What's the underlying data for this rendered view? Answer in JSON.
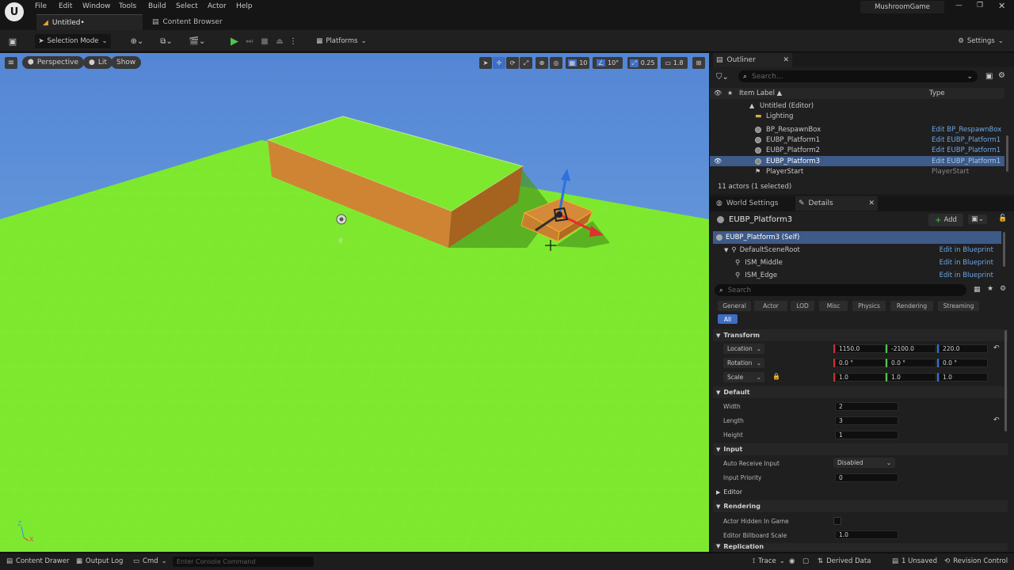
{
  "menu": [
    "File",
    "Edit",
    "Window",
    "Tools",
    "Build",
    "Select",
    "Actor",
    "Help"
  ],
  "project_name": "MushroomGame",
  "tabs": {
    "level": "Untitled•",
    "content_browser": "Content Browser"
  },
  "toolbar": {
    "selection_mode": "Selection Mode",
    "platforms": "Platforms",
    "settings": "Settings"
  },
  "viewport": {
    "perspective": "Perspective",
    "lit": "Lit",
    "show": "Show",
    "grid_snap": "10",
    "rotation_snap": "10°",
    "scale_snap": "0.25",
    "camera_speed": "1.8",
    "axis_z": "Z",
    "axis_x": "X"
  },
  "outliner": {
    "title": "Outliner",
    "search_placeholder": "Search...",
    "col_label": "Item Label ▲",
    "col_type": "Type",
    "rows": [
      {
        "label": "Untitled (Editor)",
        "type": ""
      },
      {
        "label": "Lighting",
        "type": ""
      },
      {
        "label": "BP_RespawnBox",
        "type": "Edit BP_RespawnBox"
      },
      {
        "label": "EUBP_Platform1",
        "type": "Edit EUBP_Platform1"
      },
      {
        "label": "EUBP_Platform2",
        "type": "Edit EUBP_Platform1"
      },
      {
        "label": "EUBP_Platform3",
        "type": "Edit EUBP_Platform1"
      },
      {
        "label": "PlayerStart",
        "type": "PlayerStart"
      }
    ],
    "actor_count": "11 actors (1 selected)"
  },
  "details": {
    "world_settings_tab": "World Settings",
    "details_tab": "Details",
    "actor_name": "EUBP_Platform3",
    "add_label": "Add",
    "components": [
      {
        "label": "EUBP_Platform3 (Self)",
        "edit": ""
      },
      {
        "label": "DefaultSceneRoot",
        "edit": "Edit in Blueprint"
      },
      {
        "label": "ISM_Middle",
        "edit": "Edit in Blueprint"
      },
      {
        "label": "ISM_Edge",
        "edit": "Edit in Blueprint"
      }
    ],
    "search_placeholder": "Search",
    "categories": [
      "General",
      "Actor",
      "LOD",
      "Misc",
      "Physics",
      "Rendering",
      "Streaming"
    ],
    "all_label": "All",
    "transform": {
      "title": "Transform",
      "location_label": "Location",
      "rotation_label": "Rotation",
      "scale_label": "Scale",
      "location": [
        "1150.0",
        "-2100.0",
        "220.0"
      ],
      "rotation": [
        "0.0 °",
        "0.0 °",
        "0.0 °"
      ],
      "scale": [
        "1.0",
        "1.0",
        "1.0"
      ]
    },
    "default": {
      "title": "Default",
      "width_label": "Width",
      "width": "2",
      "length_label": "Length",
      "length": "3",
      "height_label": "Height",
      "height": "1"
    },
    "input": {
      "title": "Input",
      "auto_receive_label": "Auto Receive Input",
      "auto_receive": "Disabled",
      "priority_label": "Input Priority",
      "priority": "0"
    },
    "editor_title": "Editor",
    "rendering": {
      "title": "Rendering",
      "hidden_label": "Actor Hidden In Game",
      "billboard_label": "Editor Billboard Scale",
      "billboard": "1.0"
    },
    "replication_title": "Replication"
  },
  "status": {
    "content_drawer": "Content Drawer",
    "output_log": "Output Log",
    "cmd": "Cmd",
    "console_placeholder": "Enter Console Command",
    "trace": "Trace",
    "derived_data": "Derived Data",
    "unsaved": "1 Unsaved",
    "revision_control": "Revision Control"
  },
  "colors": {
    "accent": "#3d6ec4",
    "ground": "#7ee82f",
    "platform": "#cf8433",
    "link": "#6da6e8"
  }
}
